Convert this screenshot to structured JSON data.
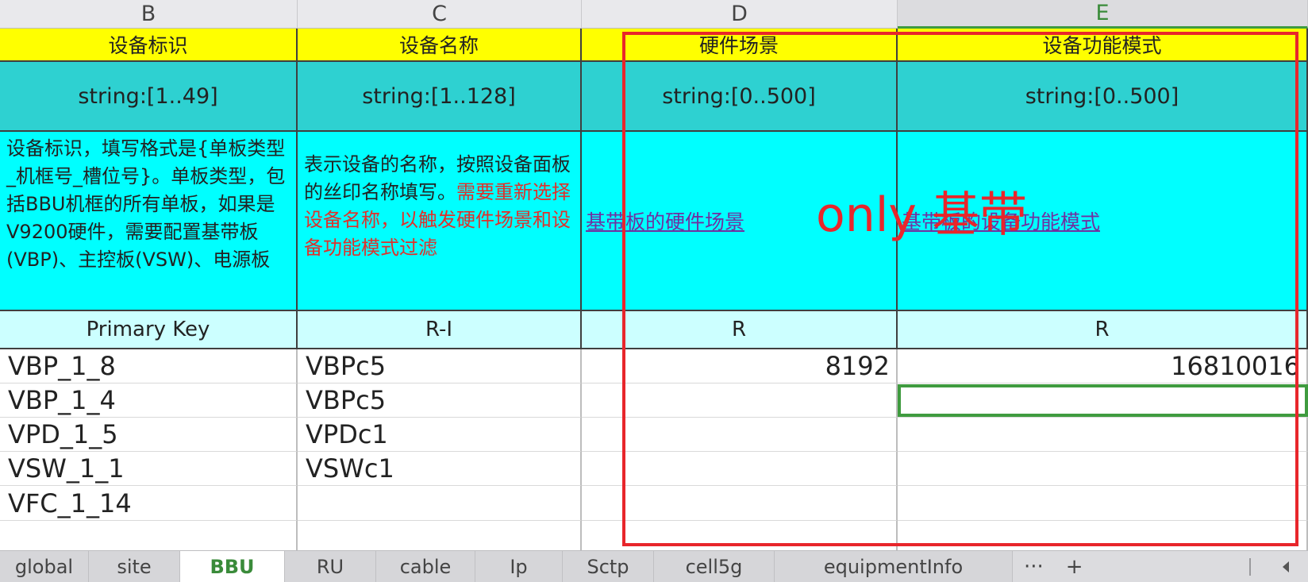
{
  "columns": [
    "B",
    "C",
    "D",
    "E"
  ],
  "header_row": [
    "设备标识",
    "设备名称",
    "硬件场景",
    "设备功能模式"
  ],
  "type_row": [
    "string:[1..49]",
    "string:[1..128]",
    "string:[0..500]",
    "string:[0..500]"
  ],
  "desc_row": {
    "b": "设备标识，填写格式是{单板类型_机框号_槽位号}。单板类型，包括BBU机框的所有单板，如果是V9200硬件，需要配置基带板(VBP)、主控板(VSW)、电源板",
    "c_normal": "表示设备的名称，按照设备面板的丝印名称填写。",
    "c_red": "需要重新选择设备名称，以触发硬件场景和设备功能模式过滤",
    "d_link": "基带板的硬件场景",
    "e_link": "基带板的设备功能模式"
  },
  "key_row": [
    "Primary Key",
    "R-I",
    "R",
    "R"
  ],
  "rows": [
    [
      "VBP_1_8",
      "VBPc5",
      "8192",
      "16810016"
    ],
    [
      "VBP_1_4",
      "VBPc5",
      "",
      ""
    ],
    [
      "VPD_1_5",
      "VPDc1",
      "",
      ""
    ],
    [
      "VSW_1_1",
      "VSWc1",
      "",
      ""
    ],
    [
      "VFC_1_14",
      "",
      "",
      ""
    ]
  ],
  "annotation": "only 基带",
  "sheet_tabs": [
    "global",
    "site",
    "BBU",
    "RU",
    "cable",
    "Ip",
    "Sctp",
    "cell5g",
    "equipmentInfo"
  ],
  "active_tab": "BBU",
  "tab_controls": {
    "more": "···",
    "add": "+"
  },
  "colors": {
    "header_yellow": "#ffff00",
    "type_teal": "#2ed1d1",
    "desc_cyan": "#00ffff",
    "key_light_cyan": "#ccffff",
    "annotation_red": "#e8262b",
    "selection_green": "#3f9b3f"
  }
}
